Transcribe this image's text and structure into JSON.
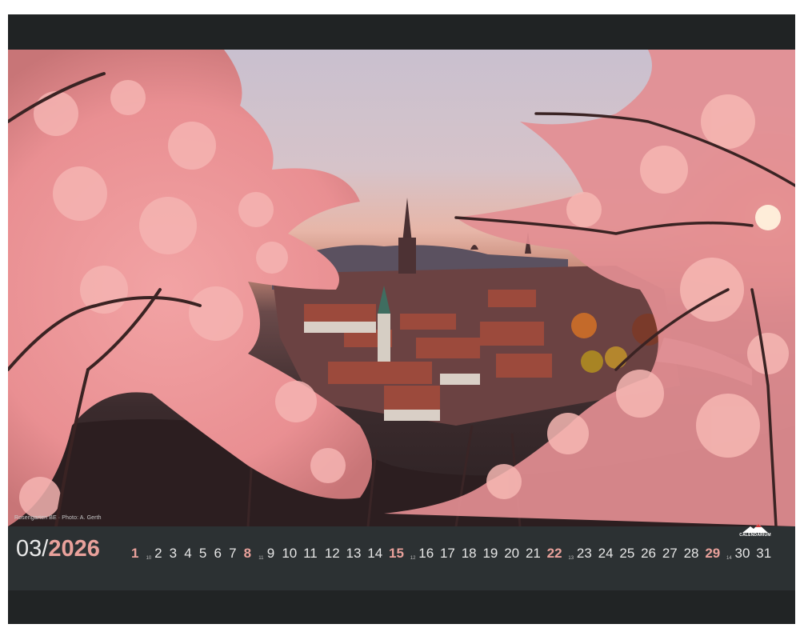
{
  "caption": "Rosengarten BE · Photo: A. Gerth",
  "publisher_logo": {
    "text": "CALENDARIUM",
    "icon": "mountain-peak-icon"
  },
  "month": "03",
  "separator": "/",
  "year": "2026",
  "accent_color": "#e9a19b",
  "days": [
    {
      "label": "1",
      "sunday": true
    },
    {
      "label": "10",
      "week": true
    },
    {
      "label": "2"
    },
    {
      "label": "3"
    },
    {
      "label": "4"
    },
    {
      "label": "5"
    },
    {
      "label": "6"
    },
    {
      "label": "7"
    },
    {
      "label": "8",
      "sunday": true
    },
    {
      "label": "11",
      "week": true
    },
    {
      "label": "9"
    },
    {
      "label": "10"
    },
    {
      "label": "11"
    },
    {
      "label": "12"
    },
    {
      "label": "13"
    },
    {
      "label": "14"
    },
    {
      "label": "15",
      "sunday": true
    },
    {
      "label": "12",
      "week": true
    },
    {
      "label": "16"
    },
    {
      "label": "17"
    },
    {
      "label": "18"
    },
    {
      "label": "19"
    },
    {
      "label": "20"
    },
    {
      "label": "21"
    },
    {
      "label": "22",
      "sunday": true
    },
    {
      "label": "13",
      "week": true
    },
    {
      "label": "23"
    },
    {
      "label": "24"
    },
    {
      "label": "25"
    },
    {
      "label": "26"
    },
    {
      "label": "27"
    },
    {
      "label": "28"
    },
    {
      "label": "29",
      "sunday": true
    },
    {
      "label": "14",
      "week": true
    },
    {
      "label": "30"
    },
    {
      "label": "31"
    }
  ]
}
